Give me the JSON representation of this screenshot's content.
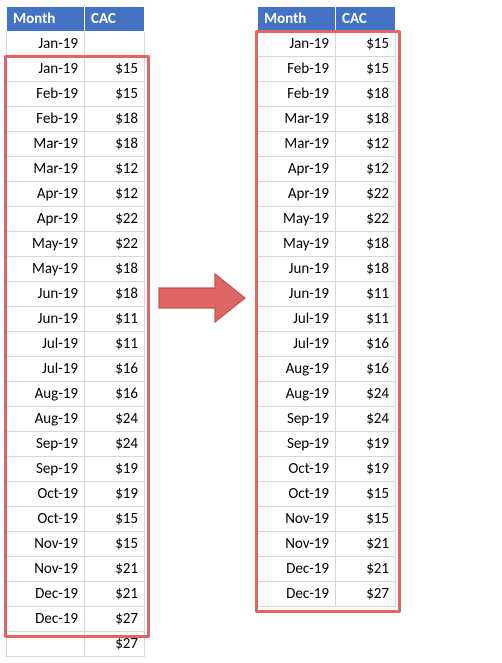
{
  "headers": {
    "month": "Month",
    "cac": "CAC"
  },
  "left": {
    "rows": [
      {
        "m": "Jan-19",
        "v": ""
      },
      {
        "m": "Jan-19",
        "v": "$15"
      },
      {
        "m": "Feb-19",
        "v": "$15"
      },
      {
        "m": "Feb-19",
        "v": "$18"
      },
      {
        "m": "Mar-19",
        "v": "$18"
      },
      {
        "m": "Mar-19",
        "v": "$12"
      },
      {
        "m": "Apr-19",
        "v": "$12"
      },
      {
        "m": "Apr-19",
        "v": "$22"
      },
      {
        "m": "May-19",
        "v": "$22"
      },
      {
        "m": "May-19",
        "v": "$18"
      },
      {
        "m": "Jun-19",
        "v": "$18"
      },
      {
        "m": "Jun-19",
        "v": "$11"
      },
      {
        "m": "Jul-19",
        "v": "$11"
      },
      {
        "m": "Jul-19",
        "v": "$16"
      },
      {
        "m": "Aug-19",
        "v": "$16"
      },
      {
        "m": "Aug-19",
        "v": "$24"
      },
      {
        "m": "Sep-19",
        "v": "$24"
      },
      {
        "m": "Sep-19",
        "v": "$19"
      },
      {
        "m": "Oct-19",
        "v": "$19"
      },
      {
        "m": "Oct-19",
        "v": "$15"
      },
      {
        "m": "Nov-19",
        "v": "$15"
      },
      {
        "m": "Nov-19",
        "v": "$21"
      },
      {
        "m": "Dec-19",
        "v": "$21"
      },
      {
        "m": "Dec-19",
        "v": "$27"
      },
      {
        "m": "",
        "v": "$27"
      }
    ],
    "box": {
      "top_row": 1,
      "bottom_row": 23
    }
  },
  "right": {
    "rows": [
      {
        "m": "Jan-19",
        "v": "$15"
      },
      {
        "m": "Feb-19",
        "v": "$15"
      },
      {
        "m": "Feb-19",
        "v": "$18"
      },
      {
        "m": "Mar-19",
        "v": "$18"
      },
      {
        "m": "Mar-19",
        "v": "$12"
      },
      {
        "m": "Apr-19",
        "v": "$12"
      },
      {
        "m": "Apr-19",
        "v": "$22"
      },
      {
        "m": "May-19",
        "v": "$22"
      },
      {
        "m": "May-19",
        "v": "$18"
      },
      {
        "m": "Jun-19",
        "v": "$18"
      },
      {
        "m": "Jun-19",
        "v": "$11"
      },
      {
        "m": "Jul-19",
        "v": "$11"
      },
      {
        "m": "Jul-19",
        "v": "$16"
      },
      {
        "m": "Aug-19",
        "v": "$16"
      },
      {
        "m": "Aug-19",
        "v": "$24"
      },
      {
        "m": "Sep-19",
        "v": "$24"
      },
      {
        "m": "Sep-19",
        "v": "$19"
      },
      {
        "m": "Oct-19",
        "v": "$19"
      },
      {
        "m": "Oct-19",
        "v": "$15"
      },
      {
        "m": "Nov-19",
        "v": "$15"
      },
      {
        "m": "Nov-19",
        "v": "$21"
      },
      {
        "m": "Dec-19",
        "v": "$21"
      },
      {
        "m": "Dec-19",
        "v": "$27"
      }
    ],
    "box": {
      "top_row": 0,
      "bottom_row": 22
    }
  }
}
